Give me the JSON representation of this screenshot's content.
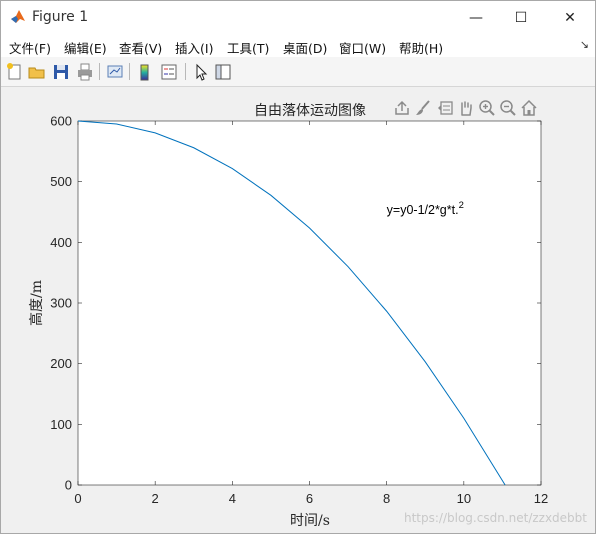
{
  "window": {
    "title": "Figure 1",
    "minimize_glyph": "—",
    "maximize_glyph": "☐",
    "close_glyph": "✕"
  },
  "menu": {
    "items": [
      "文件(F)",
      "编辑(E)",
      "查看(V)",
      "插入(I)",
      "工具(T)",
      "桌面(D)",
      "窗口(W)",
      "帮助(H)"
    ],
    "dock_glyph": "↘"
  },
  "toolbar": {
    "icons": [
      "new-figure-icon",
      "open-file-icon",
      "save-icon",
      "print-icon",
      "link-plot-icon",
      "colorbar-icon",
      "legend-icon",
      "edit-plot-icon",
      "property-inspector-icon"
    ]
  },
  "axes_toolbar": {
    "icons": [
      "export-icon",
      "brush-icon",
      "data-tips-icon",
      "pan-icon",
      "zoom-in-icon",
      "zoom-out-icon",
      "home-icon"
    ]
  },
  "chart_data": {
    "type": "line",
    "title": "自由落体运动图像",
    "xlabel": "时间/s",
    "ylabel": "高度/m",
    "xlim": [
      0,
      12
    ],
    "ylim": [
      0,
      600
    ],
    "xticks": [
      0,
      2,
      4,
      6,
      8,
      10,
      12
    ],
    "yticks": [
      0,
      100,
      200,
      300,
      400,
      500,
      600
    ],
    "grid": false,
    "series": [
      {
        "color": "#0072BD",
        "x": [
          0,
          1,
          2,
          3,
          4,
          5,
          6,
          7,
          8,
          9,
          10,
          11.07
        ],
        "y": [
          600,
          595.1,
          580.4,
          555.9,
          521.6,
          477.5,
          423.6,
          359.9,
          286.4,
          203.1,
          110,
          0
        ]
      }
    ],
    "annotation": {
      "text": "y=y0-1/2*g*t.",
      "superscript": "2",
      "x": 8.0,
      "y": 440
    }
  },
  "watermark": "https://blog.csdn.net/zzxdebbt"
}
